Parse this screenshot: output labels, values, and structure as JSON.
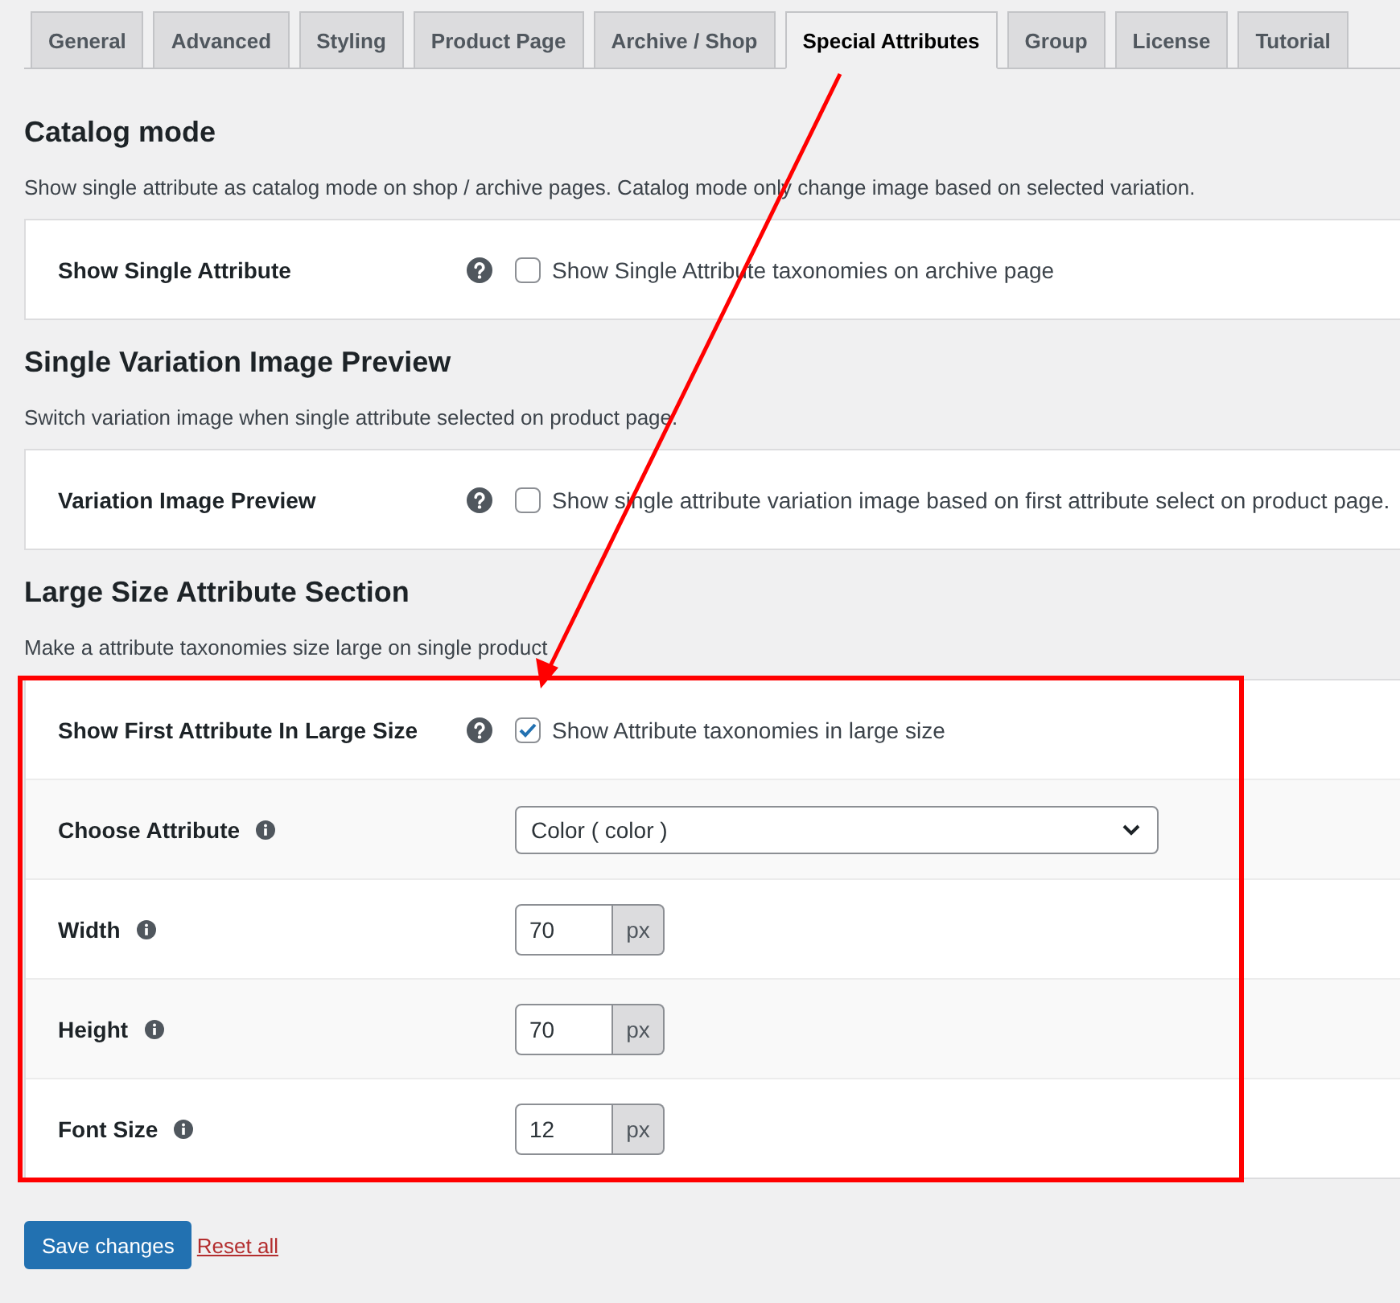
{
  "tabs": [
    {
      "label": "General",
      "selected": false
    },
    {
      "label": "Advanced",
      "selected": false
    },
    {
      "label": "Styling",
      "selected": false
    },
    {
      "label": "Product Page",
      "selected": false
    },
    {
      "label": "Archive / Shop",
      "selected": false
    },
    {
      "label": "Special Attributes",
      "selected": true
    },
    {
      "label": "Group",
      "selected": false
    },
    {
      "label": "License",
      "selected": false
    },
    {
      "label": "Tutorial",
      "selected": false
    }
  ],
  "sections": [
    {
      "title": "Catalog mode",
      "description": "Show single attribute as catalog mode on shop / archive pages. Catalog mode only change image based on selected variation.",
      "highlighted": false,
      "rows": [
        {
          "kind": "checkbox",
          "label": "Show Single Attribute",
          "checked": false,
          "text": "Show Single Attribute taxonomies on archive page"
        }
      ]
    },
    {
      "title": "Single Variation Image Preview",
      "description": "Switch variation image when single attribute selected on product page.",
      "highlighted": false,
      "rows": [
        {
          "kind": "checkbox",
          "label": "Variation Image Preview",
          "checked": false,
          "text": "Show single attribute variation image based on first attribute select on product page."
        }
      ]
    },
    {
      "title": "Large Size Attribute Section",
      "description": "Make a attribute taxonomies size large on single product",
      "highlighted": true,
      "rows": [
        {
          "kind": "checkbox",
          "label": "Show First Attribute In Large Size",
          "checked": true,
          "text": "Show Attribute taxonomies in large size"
        },
        {
          "kind": "select",
          "label": "Choose Attribute",
          "value": "Color ( color )"
        },
        {
          "kind": "number",
          "label": "Width",
          "value": "70",
          "unit": "px"
        },
        {
          "kind": "number",
          "label": "Height",
          "value": "70",
          "unit": "px"
        },
        {
          "kind": "number",
          "label": "Font Size",
          "value": "12",
          "unit": "px"
        }
      ]
    }
  ],
  "actions": {
    "save": "Save changes",
    "reset": "Reset all"
  }
}
